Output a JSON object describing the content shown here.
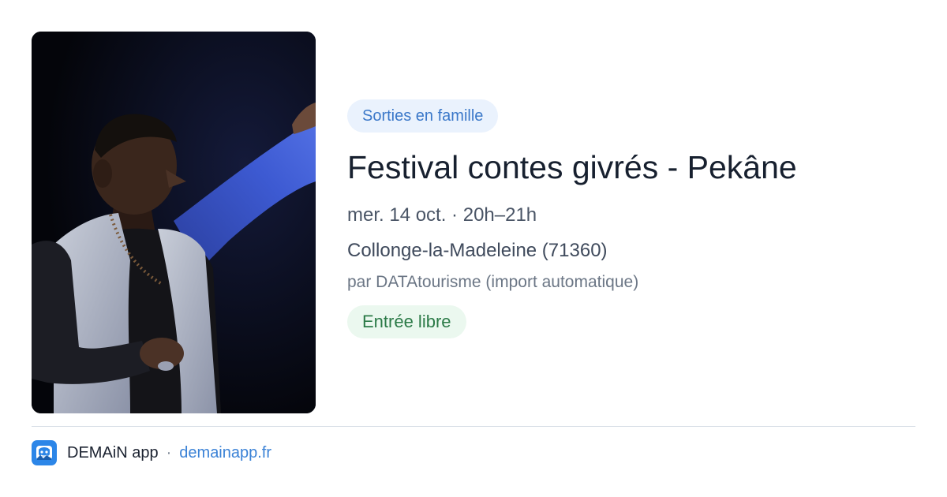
{
  "event": {
    "category": "Sorties en famille",
    "title": "Festival contes givrés - Pekâne",
    "date_time": "mer. 14 oct. · 20h–21h",
    "location": "Collonge-la-Madeleine (71360)",
    "source": "par DATAtourisme (import automatique)",
    "price": "Entrée libre"
  },
  "footer": {
    "app_name": "DEMAiN app",
    "separator": "·",
    "url": "demainapp.fr",
    "icon": "demain-app-icon"
  },
  "photo": {
    "description_icon": "event-photo"
  },
  "colors": {
    "category_chip_bg": "#eaf2fd",
    "category_chip_text": "#3b78c9",
    "price_chip_bg": "#ebf8ef",
    "price_chip_text": "#2b7a47",
    "title_text": "#17202f",
    "link": "#3b82d6",
    "app_icon_bg": "#2c86e8"
  }
}
